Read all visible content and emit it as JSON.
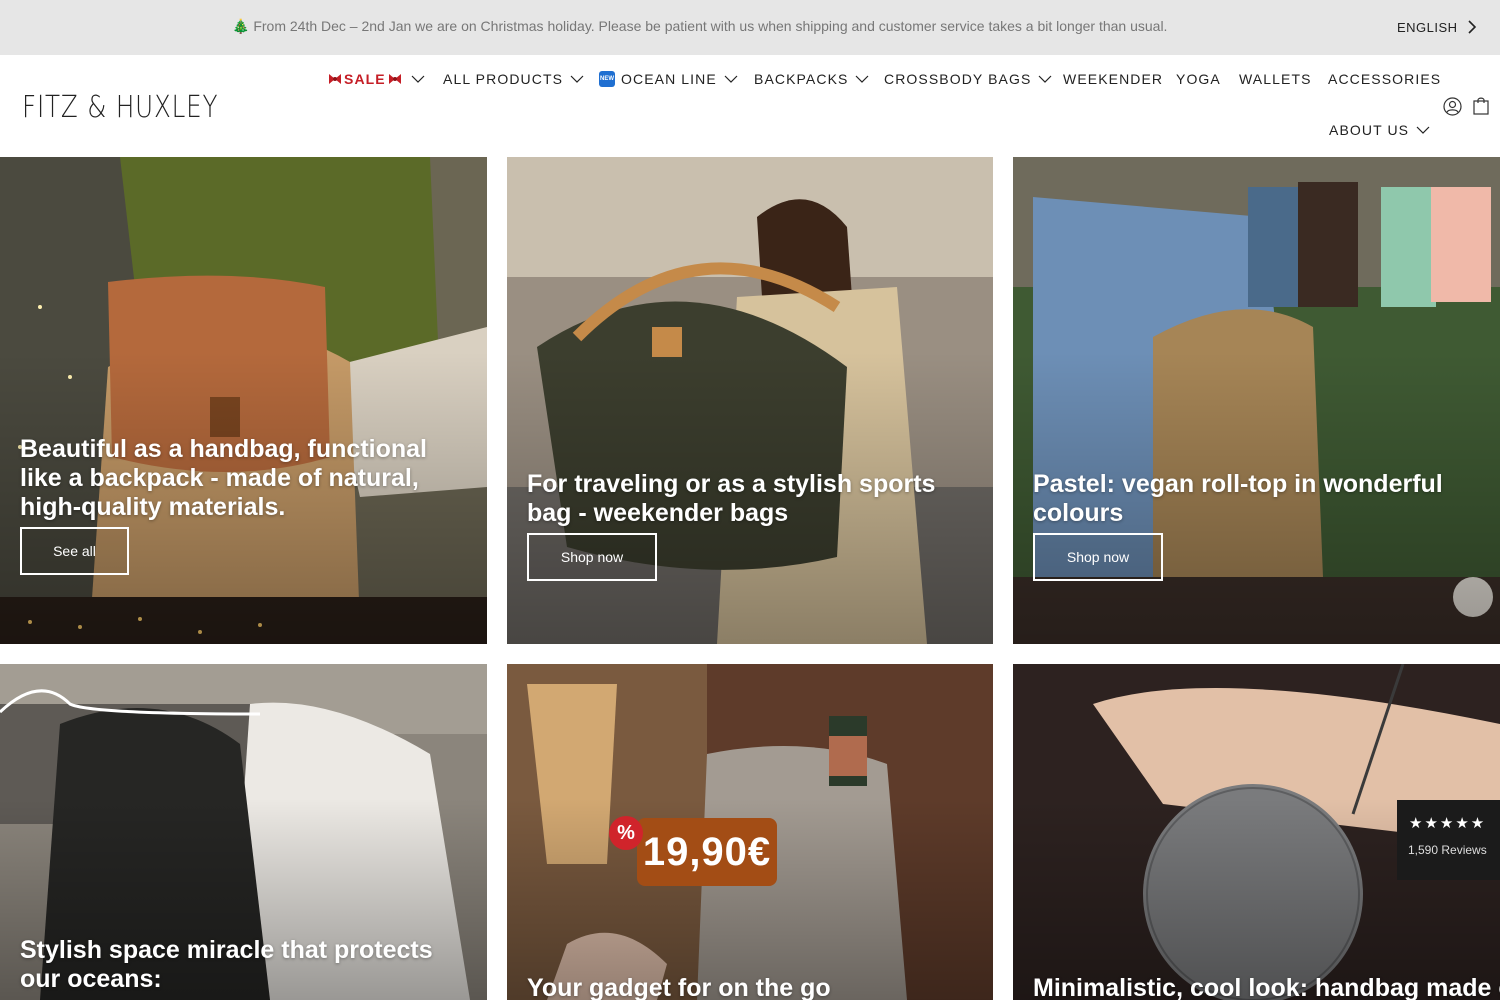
{
  "announcement": {
    "message": "🎄 From 24th Dec – 2nd Jan we are on Christmas holiday. Please be patient with us when shipping and customer service takes a bit longer than usual.",
    "language": "ENGLISH"
  },
  "header": {
    "logo": "FITZ & HUXLEY",
    "nav": {
      "sale": "SALE",
      "all_products": "ALL PRODUCTS",
      "ocean_badge": "NEW",
      "ocean_line": "OCEAN LINE",
      "backpacks": "BACKPACKS",
      "crossbody": "CROSSBODY BAGS",
      "weekender": "WEEKENDER",
      "yoga": "YOGA",
      "wallets": "WALLETS",
      "accessories": "ACCESSORIES",
      "about": "ABOUT US"
    }
  },
  "tiles": [
    {
      "caption": "Beautiful as a handbag, functional like a backpack - made of natural, high-quality materials.",
      "cta": "See all"
    },
    {
      "caption": "For traveling or as a stylish sports bag - weekender bags",
      "cta": "Shop now"
    },
    {
      "caption": "Pastel: vegan roll-top in wonderful colours",
      "cta": "Shop now"
    },
    {
      "caption": "Stylish space miracle that protects our oceans:"
    },
    {
      "caption": "Your gadget for on the go",
      "price": "19,90€",
      "percent": "%"
    },
    {
      "caption": "Minimalistic, cool look: handbag made of"
    }
  ],
  "reviews": {
    "stars": "★★★★★",
    "count": "1,590 Reviews"
  },
  "colors": {
    "sale": "#c51e26",
    "announcement_bg": "#e6e6e6",
    "price_badge": "#a34d15",
    "percent_badge": "#d0242b"
  }
}
